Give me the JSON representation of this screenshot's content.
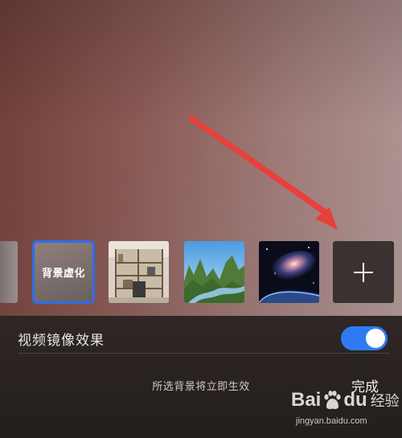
{
  "preview": {
    "background_colors": [
      "#6e3e38",
      "#b09896"
    ]
  },
  "annotation": {
    "arrow_color": "#e8403a"
  },
  "backgrounds": {
    "items": [
      {
        "id": "partial-left",
        "icon": "blurred-thumbnail"
      },
      {
        "id": "blur",
        "label": "背景虚化",
        "selected": true
      },
      {
        "id": "office",
        "icon": "office-shelves-image"
      },
      {
        "id": "mountains",
        "icon": "karst-mountains-image"
      },
      {
        "id": "galaxy",
        "icon": "galaxy-image"
      },
      {
        "id": "add",
        "icon": "plus-icon"
      }
    ],
    "selected_border_color": "#2f6de8"
  },
  "settings": {
    "mirror_label": "视频镜像效果",
    "mirror_enabled": true,
    "toggle_color": "#2f7af0",
    "hint": "所选背景将立即生效",
    "done_label": "完成"
  },
  "watermark": {
    "logo_text_1": "Bai",
    "logo_text_2": "du",
    "logo_suffix": "经验",
    "url": "jingyan.baidu.com"
  }
}
